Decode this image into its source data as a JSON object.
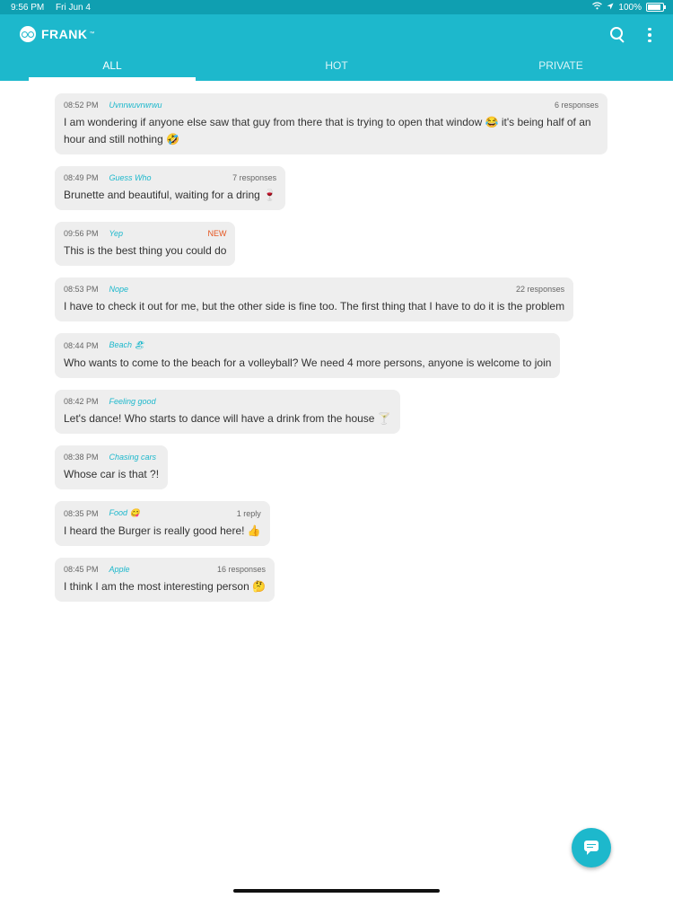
{
  "status_bar": {
    "time": "9:56 PM",
    "date": "Fri Jun 4",
    "battery": "100%"
  },
  "app": {
    "name": "FRANK",
    "trademark": "™"
  },
  "tabs": [
    {
      "label": "ALL",
      "active": true
    },
    {
      "label": "HOT",
      "active": false
    },
    {
      "label": "PRIVATE",
      "active": false
    }
  ],
  "messages": [
    {
      "time": "08:52 PM",
      "author": "Uvnrwuvrwrwu",
      "count": "6 responses",
      "text": "I am wondering if anyone else saw that guy from there that is trying to open that window 😂 it's being half of an hour and still nothing 🤣"
    },
    {
      "time": "08:49 PM",
      "author": "Guess Who",
      "count": "7 responses",
      "text": "Brunette and beautiful, waiting for a dring 🍷"
    },
    {
      "time": "09:56 PM",
      "author": "Yep",
      "count": "NEW",
      "is_new": true,
      "text": "This is the best thing you could do"
    },
    {
      "time": "08:53 PM",
      "author": "Nope",
      "count": "22 responses",
      "text": "I have to check it out for me, but the other side is fine too. The first thing that I have to do it is the problem"
    },
    {
      "time": "08:44 PM",
      "author": "Beach 🏖",
      "count": "",
      "text": "Who wants to come to the beach for a volleyball? We need 4 more persons, anyone is welcome to join"
    },
    {
      "time": "08:42 PM",
      "author": "Feeling good",
      "count": "",
      "text": "Let's dance! Who starts to dance will have a drink from the house 🍸"
    },
    {
      "time": "08:38 PM",
      "author": "Chasing cars",
      "count": "",
      "text": "Whose car is that ?!"
    },
    {
      "time": "08:35 PM",
      "author": "Food 😋",
      "count": "1 reply",
      "text": "I heard the Burger is really good here! 👍"
    },
    {
      "time": "08:45 PM",
      "author": "Apple",
      "count": "16 responses",
      "text": "I think I am the most interesting person 🤔"
    }
  ],
  "colors": {
    "primary": "#1db8cc",
    "status_bar": "#0f9fb1",
    "new_badge": "#e5551f",
    "bubble": "#eeeeee"
  },
  "icons": {
    "search": "search-icon",
    "menu": "more-vert-icon",
    "compose": "chat-bubble-icon",
    "logo": "frank-logo-icon"
  }
}
